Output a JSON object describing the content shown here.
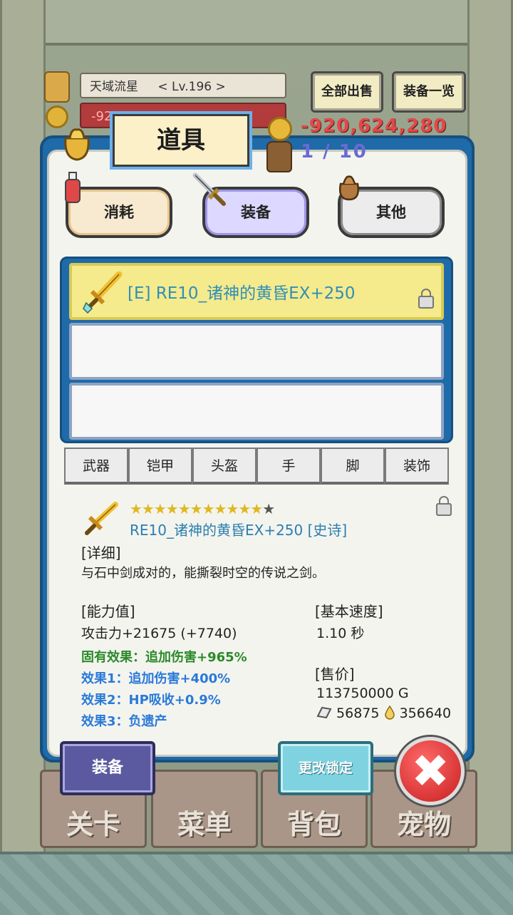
{
  "hud": {
    "player_name": "天域流星",
    "level": "< Lv.196 >",
    "gold_small": "-920,624,280"
  },
  "top_buttons": {
    "sell_all": "全部出售",
    "equip_list": "装备一览"
  },
  "panel": {
    "title": "道具",
    "gold": "-920,624,280",
    "capacity": "1 / 10"
  },
  "categories": [
    {
      "label": "消耗",
      "icon": "potion-icon"
    },
    {
      "label": "装备",
      "icon": "sword-icon",
      "selected": true
    },
    {
      "label": "其他",
      "icon": "bag-icon"
    }
  ],
  "item_list": [
    {
      "label": "[E] RE10_诸神的黄昏EX+250",
      "selected": true,
      "locked": true
    },
    {
      "label": ""
    },
    {
      "label": ""
    }
  ],
  "sub_tabs": [
    "武器",
    "铠甲",
    "头盔",
    "手",
    "脚",
    "装饰"
  ],
  "detail": {
    "stars_filled": "★★★★★★★★★★★",
    "stars_empty": "★",
    "name": "RE10_诸神的黄昏EX+250 [史诗]",
    "detail_header": "[详细]",
    "description": "与石中剑成对的，能撕裂时空的传说之剑。",
    "ability_header": "[能力值]",
    "attack": "攻击力+21675 (+7740)",
    "inherent": "固有效果：追加伤害+965%",
    "effect1": "效果1：追加伤害+400%",
    "effect2": "效果2：HP吸收+0.9%",
    "effect3": "效果3：负遗产",
    "speed_header": "[基本速度]",
    "speed": "1.10 秒",
    "price_header": "[售价]",
    "price": "113750000 G",
    "stone": "56875",
    "drop": "356640"
  },
  "bottom_buttons": {
    "equip": "装备",
    "change_lock": "更改锁定",
    "close": "✖"
  },
  "bottom_nav": [
    "关卡",
    "菜单",
    "背包",
    "宠物"
  ],
  "colors": {
    "panel_blue": "#1f6aa8",
    "selected_row": "#f5ea8c",
    "gold_red": "#e24848",
    "capacity_purple": "#6b6ad4"
  }
}
